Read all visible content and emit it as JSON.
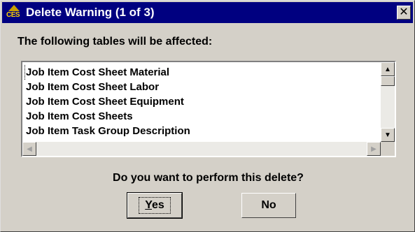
{
  "window": {
    "title": "Delete Warning (1 of 3)",
    "app_icon_text": "CES",
    "close_glyph": "✕"
  },
  "message": {
    "header": "The following tables will be affected:",
    "question": "Do you want to perform this delete?"
  },
  "table_list": [
    "Job Item Cost Sheet Material",
    "Job Item Cost Sheet Labor",
    "Job Item Cost Sheet Equipment",
    "Job Item Cost Sheets",
    "Job Item Task Group Description"
  ],
  "scrollbar": {
    "up_glyph": "▲",
    "down_glyph": "▼",
    "left_glyph": "◀",
    "right_glyph": "▶"
  },
  "buttons": {
    "yes_mnemonic": "Y",
    "yes_rest": "es",
    "no_label": "No"
  }
}
